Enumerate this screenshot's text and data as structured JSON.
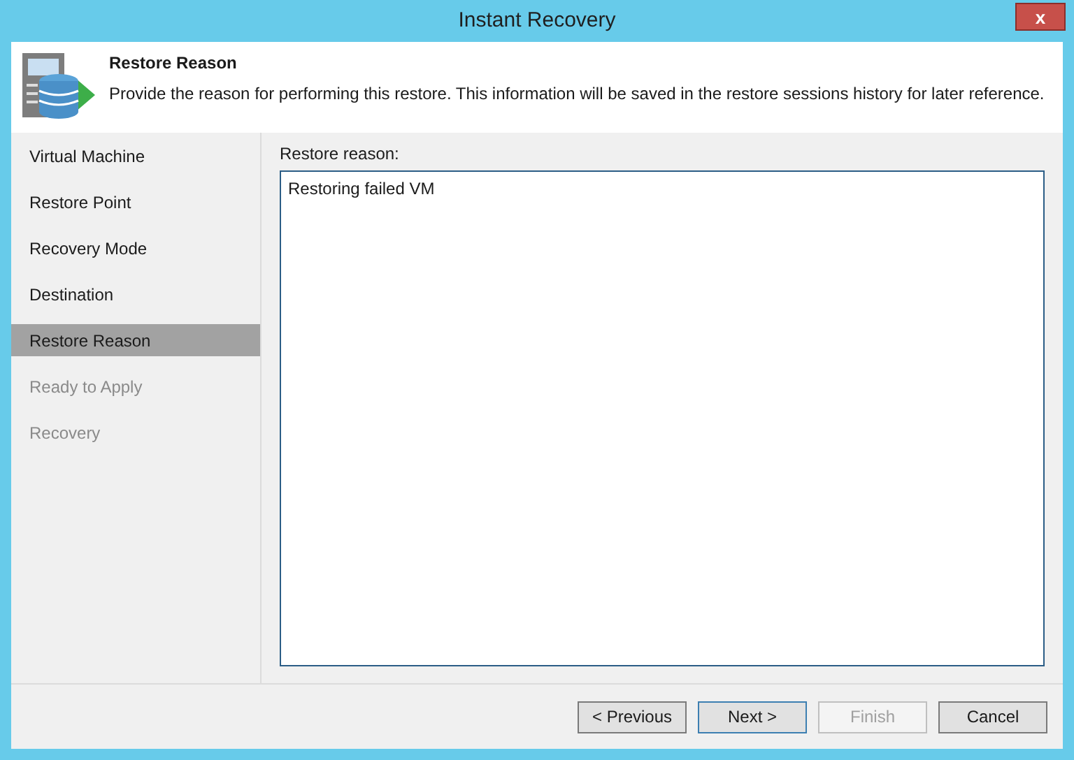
{
  "window": {
    "title": "Instant Recovery",
    "close": "x"
  },
  "header": {
    "title": "Restore Reason",
    "description": "Provide the reason for performing this restore. This information will be saved in the restore sessions history for later reference."
  },
  "steps": [
    {
      "label": "Virtual Machine",
      "selected": false,
      "disabled": false
    },
    {
      "label": "Restore Point",
      "selected": false,
      "disabled": false
    },
    {
      "label": "Recovery Mode",
      "selected": false,
      "disabled": false
    },
    {
      "label": "Destination",
      "selected": false,
      "disabled": false
    },
    {
      "label": "Restore Reason",
      "selected": true,
      "disabled": false
    },
    {
      "label": "Ready to Apply",
      "selected": false,
      "disabled": true
    },
    {
      "label": "Recovery",
      "selected": false,
      "disabled": true
    }
  ],
  "reason": {
    "label": "Restore reason:",
    "value": "Restoring failed VM"
  },
  "buttons": [
    {
      "label": "< Previous",
      "disabled": false,
      "default": false
    },
    {
      "label": "Next >",
      "disabled": false,
      "default": true
    },
    {
      "label": "Finish",
      "disabled": true,
      "default": false
    },
    {
      "label": "Cancel",
      "disabled": false,
      "default": false
    }
  ]
}
